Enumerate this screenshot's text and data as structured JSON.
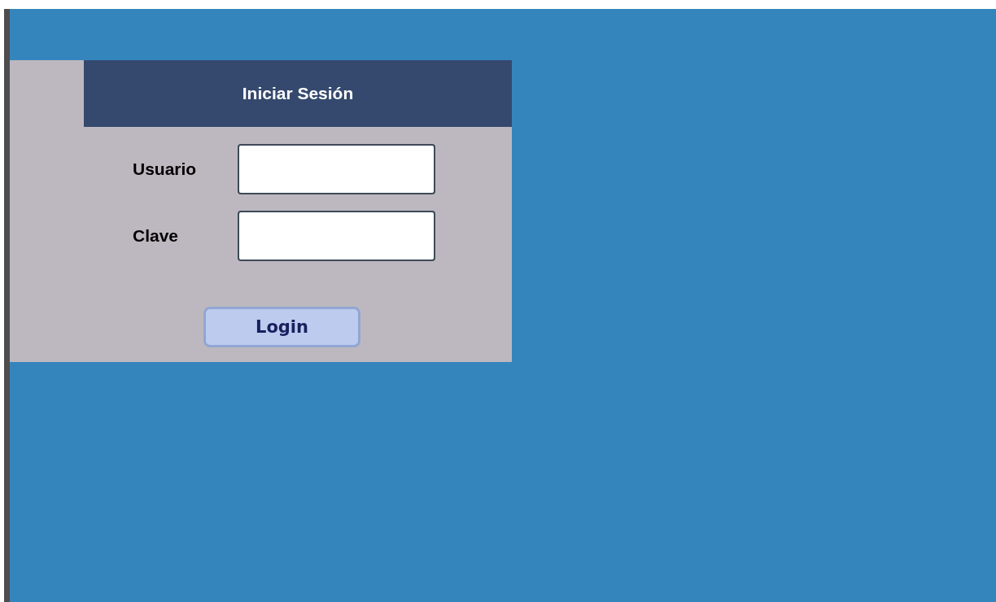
{
  "login_panel": {
    "title": "Iniciar Sesión",
    "fields": [
      {
        "label": "Usuario"
      },
      {
        "label": "Clave"
      }
    ],
    "button": "Login"
  }
}
